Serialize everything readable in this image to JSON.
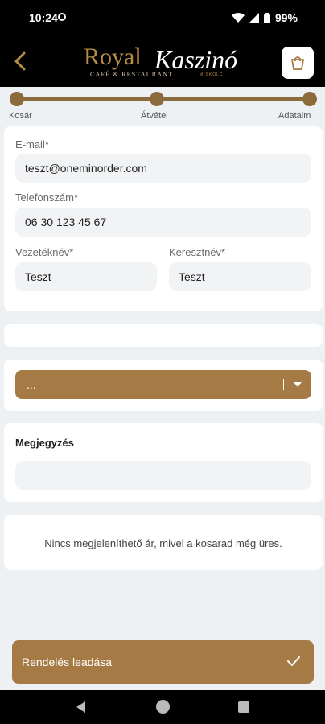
{
  "status_bar": {
    "time": "10:24",
    "battery": "99%"
  },
  "header": {
    "logo_royal": "Royal",
    "logo_kaszino": "Kaszinó",
    "logo_sub": "CAFÉ & RESTAURANT",
    "logo_sub2": "MISKOLC"
  },
  "progress": {
    "steps": [
      "Kosár",
      "Átvétel",
      "Adataim"
    ]
  },
  "form": {
    "email_label": "E-mail*",
    "email_value": "teszt@oneminorder.com",
    "phone_label": "Telefonszám*",
    "phone_value": "06 30 123 45 67",
    "lastname_label": "Vezetéknév*",
    "lastname_value": "Teszt",
    "firstname_label": "Keresztnév*",
    "firstname_value": "Teszt"
  },
  "dropdown": {
    "value": "..."
  },
  "note": {
    "title": "Megjegyzés",
    "value": ""
  },
  "price_info": {
    "message": "Nincs megjeleníthető ár, mivel a kosarad még üres."
  },
  "order_button": {
    "label": "Rendelés leadása"
  },
  "colors": {
    "accent": "#a57a44",
    "progress": "#8b6a3c",
    "background": "#eef1f4"
  }
}
